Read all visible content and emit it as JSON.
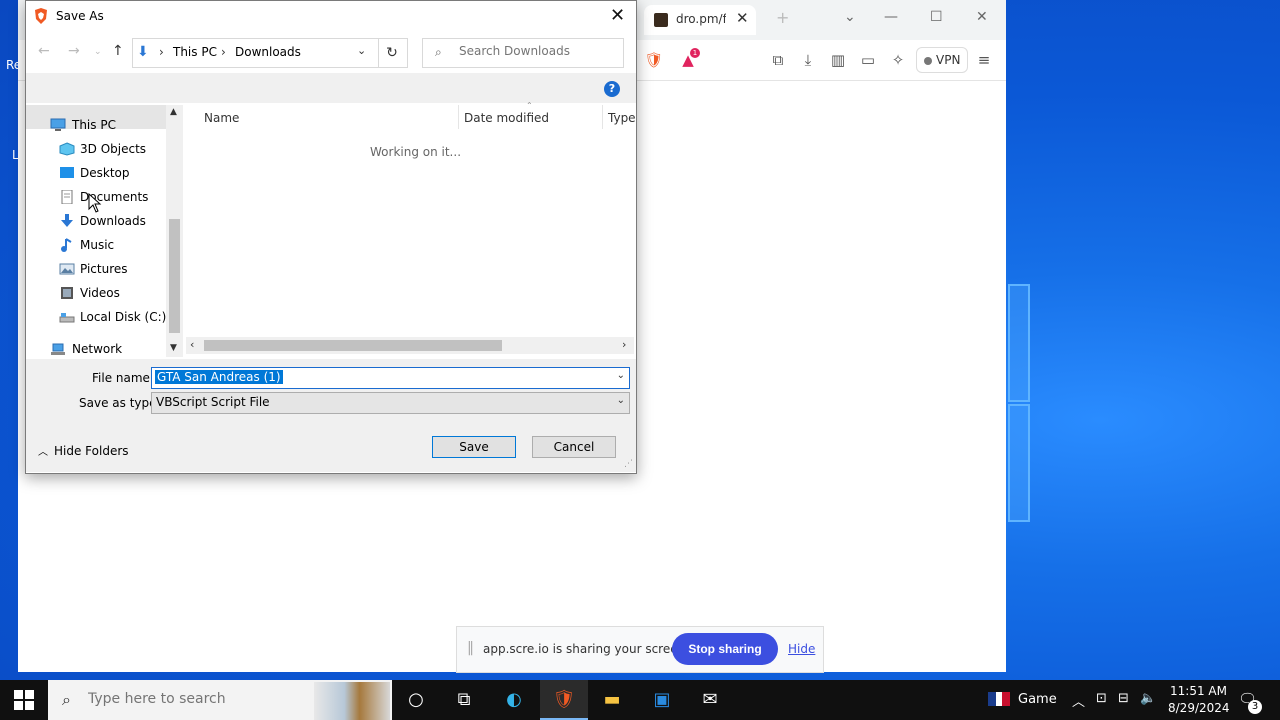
{
  "desktop": {
    "label_re": "Re",
    "label_l": "L"
  },
  "browser": {
    "tab_title": "dro.pm/f",
    "vpn_label": "VPN",
    "notification_badge": "1"
  },
  "share_bar": {
    "message": "app.scre.io is sharing your screen.",
    "stop_label": "Stop sharing",
    "hide_label": "Hide"
  },
  "dialog": {
    "title": "Save As",
    "breadcrumb": [
      "This PC",
      "Downloads"
    ],
    "search_placeholder": "Search Downloads",
    "tree": [
      {
        "label": "This PC",
        "icon": "pc-icon"
      },
      {
        "label": "3D Objects",
        "icon": "3d-objects-icon"
      },
      {
        "label": "Desktop",
        "icon": "desktop-folder-icon"
      },
      {
        "label": "Documents",
        "icon": "documents-folder-icon"
      },
      {
        "label": "Downloads",
        "icon": "downloads-folder-icon"
      },
      {
        "label": "Music",
        "icon": "music-folder-icon"
      },
      {
        "label": "Pictures",
        "icon": "pictures-folder-icon"
      },
      {
        "label": "Videos",
        "icon": "videos-folder-icon"
      },
      {
        "label": "Local Disk (C:)",
        "icon": "local-disk-icon"
      },
      {
        "label": "Network",
        "icon": "network-icon"
      }
    ],
    "selected_tree_item": "Downloads",
    "columns": [
      "Name",
      "Date modified",
      "Type"
    ],
    "status_text": "Working on it...",
    "file_name_label": "File name:",
    "file_name_value": "GTA San Andreas (1)",
    "save_type_label": "Save as type:",
    "save_type_value": "VBScript Script File",
    "hide_folders_label": "Hide Folders",
    "save_label": "Save",
    "cancel_label": "Cancel"
  },
  "taskbar": {
    "search_placeholder": "Type here to search",
    "game_label": "Game",
    "time": "11:51 AM",
    "date": "8/29/2024",
    "notification_count": "3"
  },
  "colors": {
    "accent": "#0078d7",
    "share_button": "#3c4fe0",
    "desktop_blue": "#0b58d6"
  }
}
